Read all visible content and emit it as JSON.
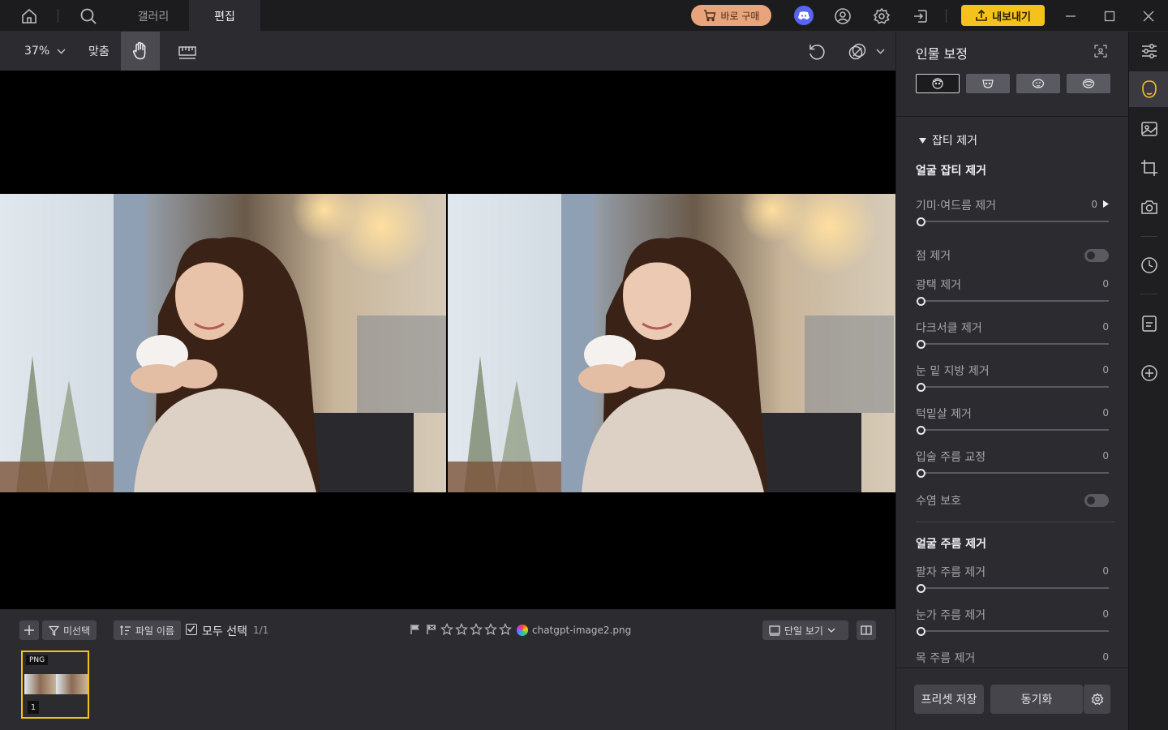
{
  "topbar": {
    "tabs": [
      {
        "label": "갤러리"
      },
      {
        "label": "편집"
      }
    ],
    "buy_label": "바로 구매",
    "export_label": "내보내기"
  },
  "toolbar": {
    "zoom": "37%",
    "fit_label": "맞춤"
  },
  "filmstrip": {
    "filter_label": "미선택",
    "sort_label": "파일 이름",
    "select_all_label": "모두 선택",
    "count": "1/1",
    "filename": "chatgpt-image2.png",
    "view_mode": "단일 보기",
    "thumb_badge": "PNG",
    "thumb_index": "1"
  },
  "panel": {
    "title": "인물 보정",
    "section_header": "잡티 제거",
    "group1_title": "얼굴 잡티 제거",
    "group2_title": "얼굴 주름 제거",
    "sliders1": [
      {
        "label": "기미·여드름 제거",
        "value": "0"
      },
      {
        "label": "광택 제거",
        "value": "0"
      },
      {
        "label": "다크서클 제거",
        "value": "0"
      },
      {
        "label": "눈 밑 지방 제거",
        "value": "0"
      },
      {
        "label": "턱밑살 제거",
        "value": "0"
      },
      {
        "label": "입술 주름 교정",
        "value": "0"
      }
    ],
    "toggles": [
      {
        "label": "점 제거",
        "state": "off"
      },
      {
        "label": "수염 보호",
        "state": "off"
      }
    ],
    "sliders2": [
      {
        "label": "팔자 주름 제거",
        "value": "0"
      },
      {
        "label": "눈가 주름 제거",
        "value": "0"
      },
      {
        "label": "목 주름 제거",
        "value": "0"
      }
    ],
    "preset_save_label": "프리셋 저장",
    "sync_label": "동기화"
  },
  "colors": {
    "accent_yellow": "#f4c21a",
    "buy_orange": "#e8a57c",
    "discord": "#5865f2",
    "panel_bg": "#2c2c30"
  }
}
